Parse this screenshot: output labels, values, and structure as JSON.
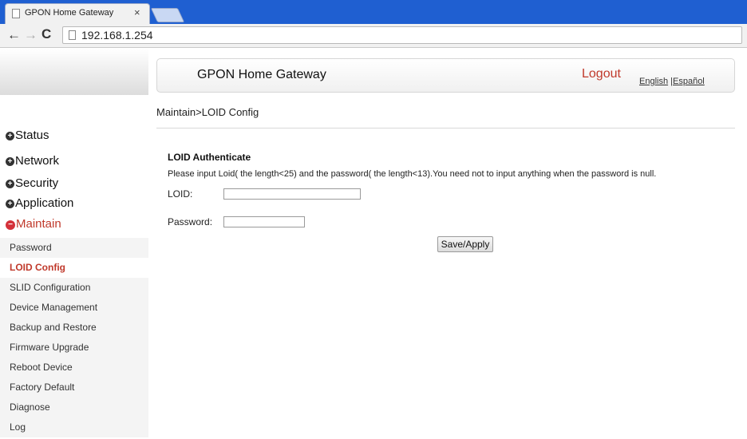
{
  "browser": {
    "tab_title": "GPON Home Gateway",
    "tab_close": "×",
    "address": "192.168.1.254",
    "back_glyph": "←",
    "forward_glyph": "→",
    "reload_glyph": "C"
  },
  "header": {
    "title": "GPON Home Gateway",
    "logout": "Logout",
    "lang_english": "English",
    "lang_separator": " |",
    "lang_spanish": "Español"
  },
  "breadcrumb": "Maintain>LOID Config",
  "sidebar": {
    "menu": [
      {
        "label": "Status",
        "bullet": "+"
      },
      {
        "label": "Network",
        "bullet": "+"
      },
      {
        "label": "Security",
        "bullet": "+"
      },
      {
        "label": "Application",
        "bullet": "+"
      },
      {
        "label": "Maintain",
        "bullet": "−"
      }
    ],
    "submenu": [
      "Password",
      "LOID Config",
      "SLID Configuration",
      "Device Management",
      "Backup and Restore",
      "Firmware Upgrade",
      "Reboot Device",
      "Factory Default",
      "Diagnose",
      "Log"
    ]
  },
  "form": {
    "section_title": "LOID Authenticate",
    "instructions": "Please input Loid( the length<25) and the password( the length<13).You need not to input anything when the password is null.",
    "loid_label": "LOID:",
    "loid_value": "",
    "password_label": "Password:",
    "password_value": "",
    "save_label": "Save/Apply"
  },
  "colors": {
    "chrome": "#1f5fd1",
    "accent_red": "#c0392b"
  }
}
